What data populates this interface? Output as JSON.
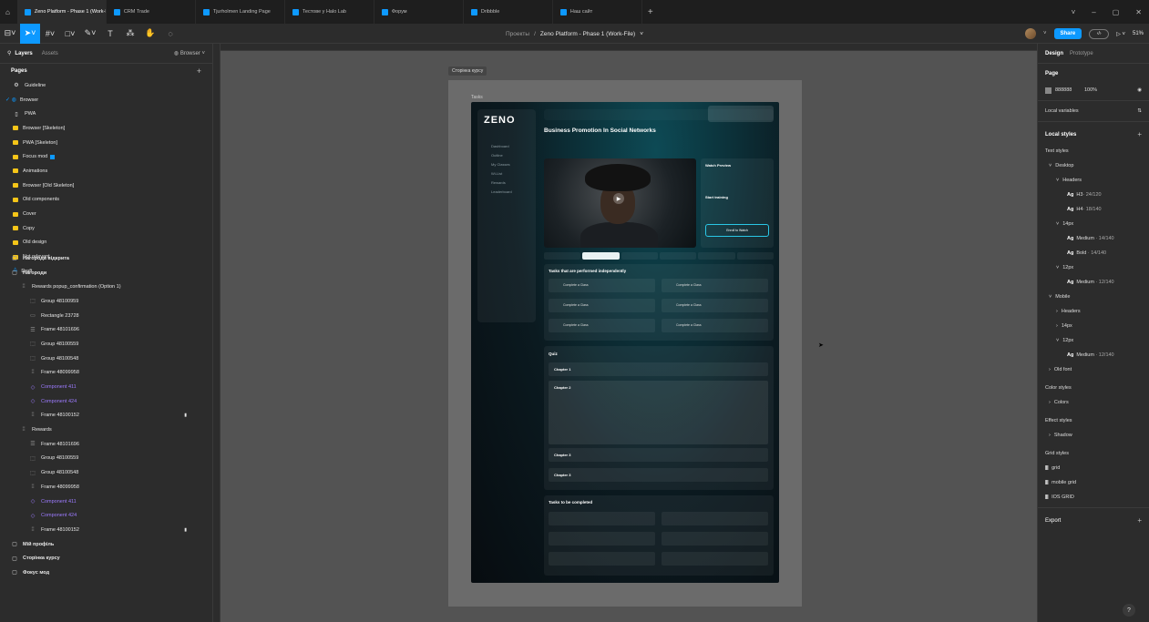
{
  "tabs": [
    {
      "label": "Zeno Platform - Phase 1 (Work-Fil",
      "active": true
    },
    {
      "label": "CRM Trade",
      "active": false
    },
    {
      "label": "Tjurholmen Landing Page",
      "active": false
    },
    {
      "label": "Тестове у Halo Lab",
      "active": false
    },
    {
      "label": "Форум",
      "active": false
    },
    {
      "label": "Dribbble",
      "active": false
    },
    {
      "label": "Наш сайт",
      "active": false
    }
  ],
  "toolbar": {
    "breadcrumb_project": "Проекты",
    "breadcrumb_sep": "/",
    "file_name": "Zeno Platform - Phase 1 (Work-File)",
    "share_label": "Share",
    "zoom": "51%",
    "play_label": "▷ ˅",
    "accent": "#0d99ff"
  },
  "left_panel": {
    "tab_layers": "Layers",
    "tab_assets": "Assets",
    "page_selector": "Browser",
    "pages_title": "Pages",
    "pages": [
      {
        "label": "Guideline",
        "icon": "gear-icon",
        "glyph": "⚙",
        "type": "plain"
      },
      {
        "label": "Browser",
        "icon": "browser-icon",
        "glyph": "✓ ◍",
        "type": "current"
      },
      {
        "label": "PWA",
        "icon": "mobile-icon",
        "glyph": "▯",
        "type": "plain"
      },
      {
        "label": "Browser [Skeleton]",
        "icon": "folder-icon",
        "type": "folder"
      },
      {
        "label": "PWA [Skeleton]",
        "icon": "folder-icon",
        "type": "folder"
      },
      {
        "label": "Focus mod",
        "icon": "folder-icon",
        "type": "folder",
        "badge": true
      },
      {
        "label": "Animations",
        "icon": "folder-icon",
        "type": "folder"
      },
      {
        "label": "Browser [Old Skeleton]",
        "icon": "folder-icon",
        "type": "folder"
      },
      {
        "label": "Old components",
        "icon": "folder-icon",
        "type": "folder"
      },
      {
        "label": "Cover",
        "icon": "folder-icon",
        "type": "folder"
      },
      {
        "label": "Copy",
        "icon": "folder-icon",
        "type": "folder"
      },
      {
        "label": "Old design",
        "icon": "folder-icon",
        "type": "folder"
      },
      {
        "label": "Not relevant",
        "icon": "folder-icon",
        "type": "folder"
      },
      {
        "label": "Draft",
        "icon": "draft-icon",
        "glyph": "⟁",
        "type": "draft"
      }
    ],
    "layers": [
      {
        "label": "Нагорода відкрита",
        "indent": 0,
        "icon": "frame-icon",
        "glyph": "▢",
        "bold": true
      },
      {
        "label": "Нагороди",
        "indent": 0,
        "icon": "frame-icon",
        "glyph": "▢",
        "bold": true
      },
      {
        "label": "Rewards popup_confirmation (Option 1)",
        "indent": 1,
        "icon": "grid-icon",
        "glyph": "⁞⁞"
      },
      {
        "label": "Group 48100959",
        "indent": 2,
        "icon": "group-icon",
        "glyph": "⬚"
      },
      {
        "label": "Rectangle 23728",
        "indent": 2,
        "icon": "rectangle-icon",
        "glyph": "▭"
      },
      {
        "label": "Frame 48101696",
        "indent": 2,
        "icon": "auto-layout-icon",
        "glyph": "☰"
      },
      {
        "label": "Group 48100559",
        "indent": 2,
        "icon": "group-icon",
        "glyph": "⬚"
      },
      {
        "label": "Group 48100548",
        "indent": 2,
        "icon": "group-icon",
        "glyph": "⬚"
      },
      {
        "label": "Frame 48099958",
        "indent": 2,
        "icon": "grid-icon",
        "glyph": "⁞⁞"
      },
      {
        "label": "Component 411",
        "indent": 2,
        "icon": "instance-icon",
        "glyph": "◇",
        "purple": true
      },
      {
        "label": "Component 424",
        "indent": 2,
        "icon": "instance-icon",
        "glyph": "◇",
        "purple": true
      },
      {
        "label": "Frame 48100152",
        "indent": 2,
        "icon": "grid-icon",
        "glyph": "⁞⁞",
        "locked": true
      },
      {
        "label": "Rewards",
        "indent": 1,
        "icon": "grid-icon",
        "glyph": "⁞⁞"
      },
      {
        "label": "Frame 48101696",
        "indent": 2,
        "icon": "auto-layout-icon",
        "glyph": "☰"
      },
      {
        "label": "Group 48100559",
        "indent": 2,
        "icon": "group-icon",
        "glyph": "⬚"
      },
      {
        "label": "Group 48100548",
        "indent": 2,
        "icon": "group-icon",
        "glyph": "⬚"
      },
      {
        "label": "Frame 48099958",
        "indent": 2,
        "icon": "grid-icon",
        "glyph": "⁞⁞"
      },
      {
        "label": "Component 411",
        "indent": 2,
        "icon": "instance-icon",
        "glyph": "◇",
        "purple": true
      },
      {
        "label": "Component 424",
        "indent": 2,
        "icon": "instance-icon",
        "glyph": "◇",
        "purple": true
      },
      {
        "label": "Frame 48100152",
        "indent": 2,
        "icon": "grid-icon",
        "glyph": "⁞⁞",
        "locked": true
      },
      {
        "label": "Мій профіль",
        "indent": 0,
        "icon": "frame-icon",
        "glyph": "▢",
        "bold": true
      },
      {
        "label": "Сторінка курсу",
        "indent": 0,
        "icon": "frame-icon",
        "glyph": "▢",
        "bold": true
      },
      {
        "label": "Фокус мод",
        "indent": 0,
        "icon": "frame-icon",
        "glyph": "▢",
        "bold": true
      }
    ]
  },
  "canvas": {
    "frame_label": "Сторінка курсу",
    "tasks_label": "Tasks",
    "background": "#535353",
    "app": {
      "logo": "ZENO",
      "course_title": "Business Promotion In Social Networks",
      "nav_items": [
        "Dashboard",
        "Outline",
        "My Classes",
        "Wi-List",
        "Rewards",
        "Leaderboard"
      ],
      "section_tasks_independent": "Tasks that are performed independently",
      "section_quiz": "Quiz",
      "chapters": [
        "Chapter 1",
        "Chapter 2",
        "Chapter 3",
        "Chapter 3"
      ],
      "section_tasks_to_complete": "Tasks to be completed",
      "task_label": "Complete a Class",
      "watch_preview": "Watch Preview",
      "start_training": "Start training",
      "enroll_label": "Enroll to Watch"
    }
  },
  "right_panel": {
    "tab_design": "Design",
    "tab_prototype": "Prototype",
    "page_section": "Page",
    "page_color": "888888",
    "page_opacity": "100%",
    "local_variables": "Local variables",
    "local_styles": "Local styles",
    "text_styles": "Text styles",
    "desktop": "Desktop",
    "headers": "Headers",
    "h3": "H3",
    "h3_size": "· 24/120",
    "h4": "H4",
    "h4_size": "· 18/140",
    "s14": "14px",
    "medium_14": "Medium",
    "medium_14_size": "· 14/140",
    "bold_14": "Bold",
    "bold_14_size": "· 14/140",
    "s12": "12px",
    "medium_12": "Medium",
    "medium_12_size": "· 12/140",
    "mobile": "Mobile",
    "m_headers": "Headers",
    "m_14": "14px",
    "m_12": "12px",
    "m_medium_12": "Medium",
    "m_medium_12_size": "· 12/140",
    "old_font": "Old font",
    "color_styles": "Color styles",
    "colors": "Colors",
    "effect_styles": "Effect styles",
    "shadow": "Shadow",
    "grid_styles": "Grid styles",
    "grid": "grid",
    "mobile_grid": "mobile grid",
    "ios_grid": "IOS GRID",
    "export": "Export"
  }
}
